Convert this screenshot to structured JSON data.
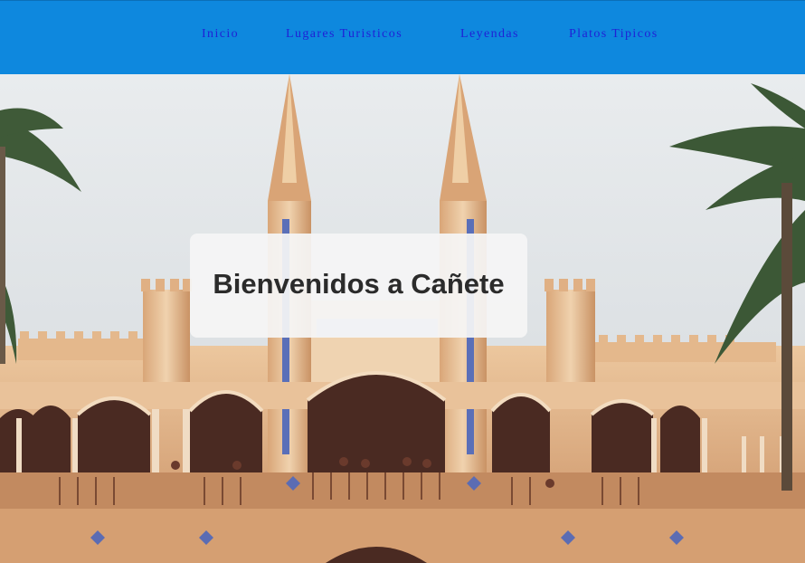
{
  "nav": {
    "items": [
      {
        "label": "Inicio"
      },
      {
        "label": "Lugares Turisticos"
      },
      {
        "label": "Leyendas"
      },
      {
        "label": "Platos Tipicos"
      }
    ]
  },
  "hero": {
    "title": "Bienvenidos a Cañete"
  },
  "colors": {
    "navbar_bg": "#0e88de",
    "nav_link": "#1f22d6",
    "sky": "#dde2e6",
    "building": "#e2b48a",
    "title_text": "#2b2b2b"
  }
}
